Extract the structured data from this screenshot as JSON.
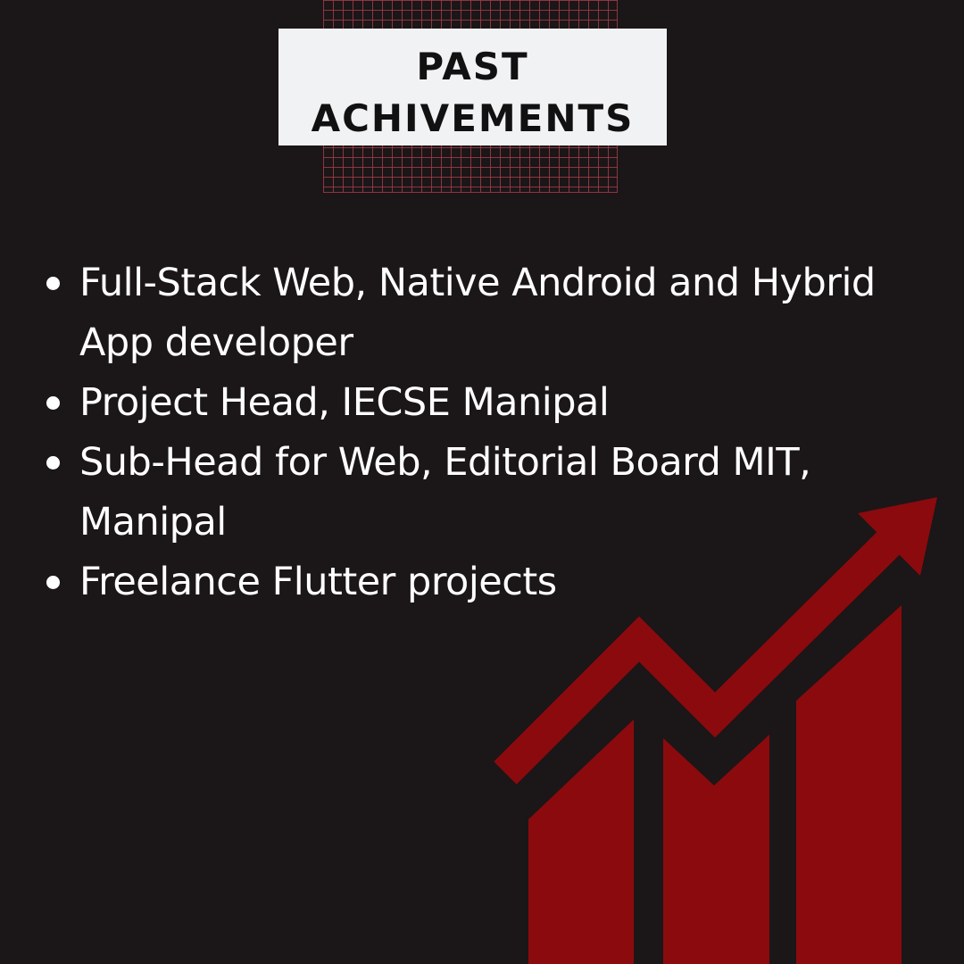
{
  "title": {
    "line1": "PAST",
    "line2": "ACHIVEMENTS"
  },
  "achievements": [
    "Full-Stack Web, Native Android and Hybrid App developer",
    "Project Head, IECSE Manipal",
    "Sub-Head for Web, Editorial Board MIT, Manipal",
    "Freelance Flutter projects"
  ],
  "colors": {
    "background": "#1b1618",
    "accent": "#8b0a0d",
    "title_box": "#f1f2f4",
    "text": "#ffffff"
  },
  "icons": {
    "growth_chart": "growth-chart-icon"
  }
}
